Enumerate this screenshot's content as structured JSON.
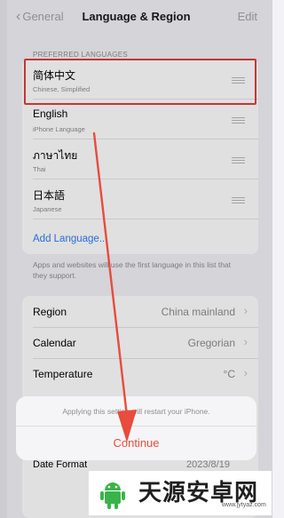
{
  "nav": {
    "back_label": "General",
    "title": "Language & Region",
    "edit_label": "Edit"
  },
  "preferred_languages": {
    "header": "PREFERRED LANGUAGES",
    "items": [
      {
        "name": "简体中文",
        "sub": "Chinese, Simplified"
      },
      {
        "name": "English",
        "sub": "iPhone Language"
      },
      {
        "name": "ภาษาไทย",
        "sub": "Thai"
      },
      {
        "name": "日本語",
        "sub": "Japanese"
      }
    ],
    "add_label": "Add Language..."
  },
  "footer_note": "Apps and websites will use the first language in this list that they support.",
  "settings": [
    {
      "label": "Region",
      "value": "China mainland"
    },
    {
      "label": "Calendar",
      "value": "Gregorian"
    },
    {
      "label": "Temperature",
      "value": "°C"
    }
  ],
  "action_sheet": {
    "message": "Applying this setting will restart your iPhone.",
    "button": "Continue"
  },
  "underlay": {
    "label": "Date Format",
    "value": "2023/8/19"
  },
  "watermark": {
    "text": "天源安卓网",
    "url": "www.jytyaz.com"
  },
  "colors": {
    "highlight": "#e23d3d",
    "arrow": "#e74c3c",
    "link": "#2f7cf6",
    "continue": "#e74c3c"
  },
  "icons": {
    "grip": "reorder-grip-icon",
    "chevron": "chevron-right-icon",
    "back": "chevron-left-icon"
  }
}
